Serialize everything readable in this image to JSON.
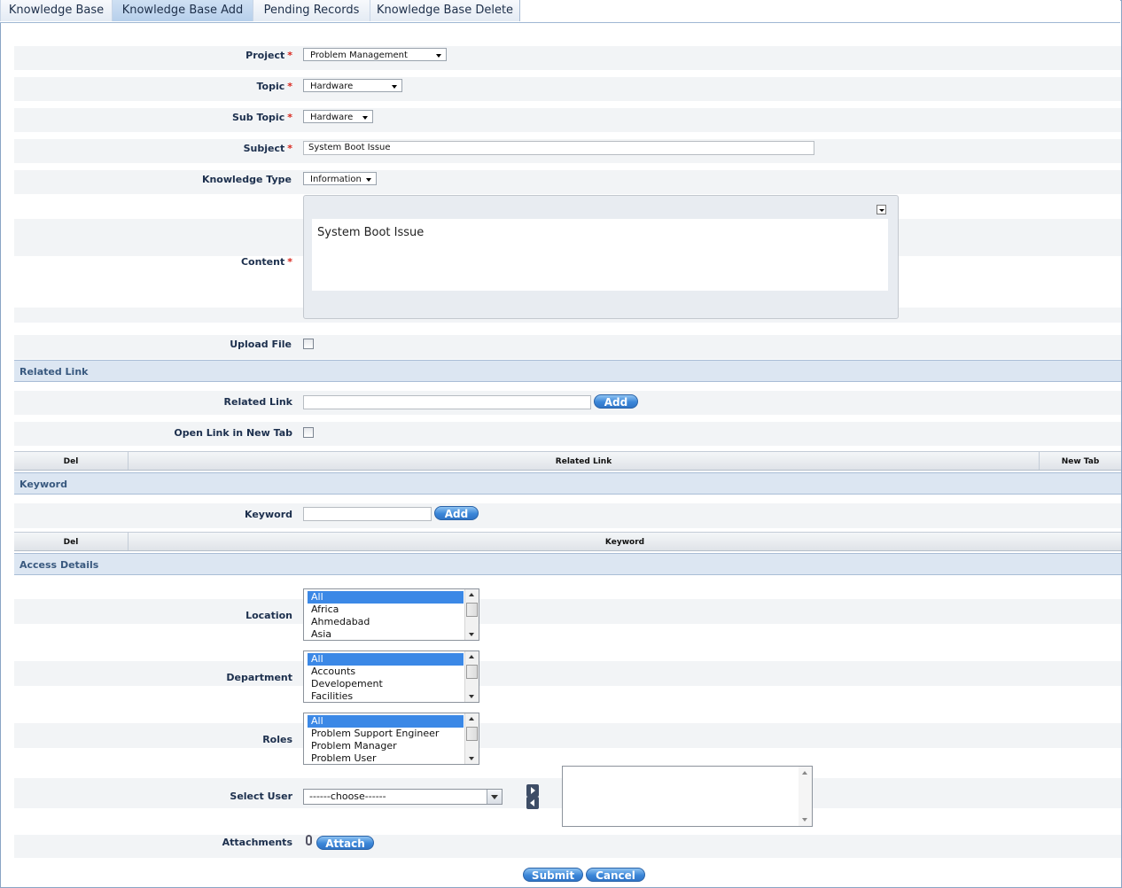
{
  "tabs": [
    {
      "label": "Knowledge Base"
    },
    {
      "label": "Knowledge Base Add"
    },
    {
      "label": "Pending Records"
    },
    {
      "label": "Knowledge Base Delete"
    }
  ],
  "form": {
    "project": {
      "label": "Project",
      "value": "Problem Management"
    },
    "topic": {
      "label": "Topic",
      "value": "Hardware"
    },
    "sub_topic": {
      "label": "Sub Topic",
      "value": "Hardware"
    },
    "subject": {
      "label": "Subject",
      "value": "System Boot Issue"
    },
    "knowledge_type": {
      "label": "Knowledge Type",
      "value": "Information"
    },
    "content": {
      "label": "Content",
      "value": "System Boot Issue"
    },
    "upload_file": {
      "label": "Upload File"
    },
    "required_mark": "*"
  },
  "related_link_section": {
    "title": "Related Link",
    "field_label": "Related Link",
    "add_label": "Add",
    "new_tab_label": "Open Link in New Tab",
    "columns": [
      "Del",
      "Related Link",
      "New Tab"
    ]
  },
  "keyword_section": {
    "title": "Keyword",
    "field_label": "Keyword",
    "add_label": "Add",
    "columns": [
      "Del",
      "Keyword"
    ]
  },
  "access_section": {
    "title": "Access Details",
    "location": {
      "label": "Location",
      "options": [
        "All",
        "Africa",
        "Ahmedabad",
        "Asia"
      ],
      "selected": "All"
    },
    "department": {
      "label": "Department",
      "options": [
        "All",
        "Accounts",
        "Developement",
        "Facilities"
      ],
      "selected": "All"
    },
    "roles": {
      "label": "Roles",
      "options": [
        "All",
        "Problem Support Engineer",
        "Problem Manager",
        "Problem User"
      ],
      "selected": "All"
    },
    "select_user": {
      "label": "Select User",
      "value": "------choose------"
    },
    "attachments": {
      "label": "Attachments",
      "attach_label": "Attach"
    }
  },
  "actions": {
    "submit_label": "Submit",
    "cancel_label": "Cancel"
  },
  "icons": [
    "dropdown-arrow-icon",
    "paperclip-icon",
    "move-right-icon",
    "move-left-icon",
    "editor-menu-icon",
    "scroll-up-icon",
    "scroll-down-icon"
  ],
  "colors": {
    "accent": "#3b86d8",
    "section_bg": "#dce6f2",
    "label": "#1c2f4d",
    "required": "#d9261c",
    "selected_option": "#3b88e6"
  }
}
